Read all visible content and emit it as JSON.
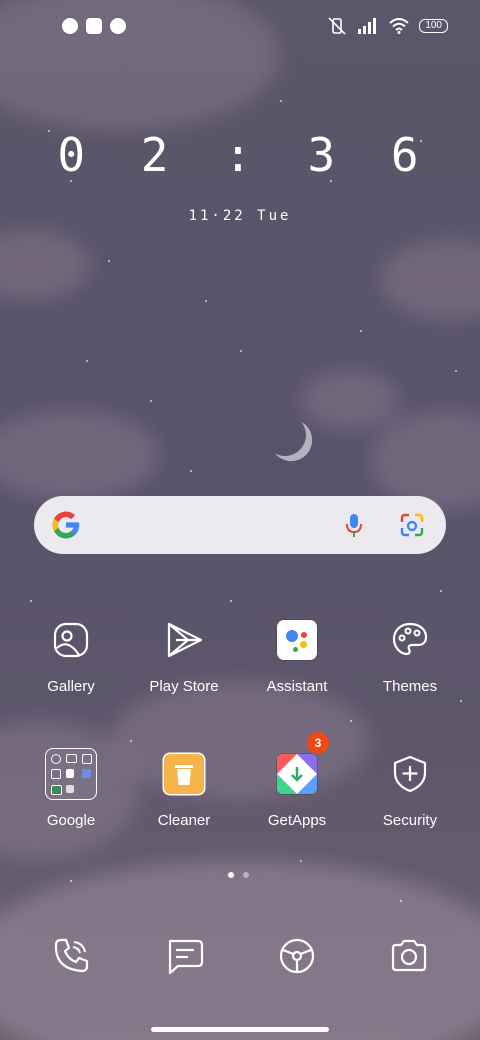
{
  "status_bar": {
    "left_icons": [
      "notification-app-icon",
      "notification-square-icon",
      "notification-app-icon"
    ],
    "battery": "100",
    "right_icons": [
      "vibrate-off-icon",
      "signal-icon",
      "wifi-icon",
      "battery-icon"
    ]
  },
  "clock": {
    "time": "02:36",
    "time_display": "0 2 : 3 6",
    "date": "11·22 Tue"
  },
  "search_bar": {
    "icons": [
      "google-logo-icon",
      "microphone-icon",
      "google-lens-icon"
    ]
  },
  "apps_row1": [
    {
      "label": "Gallery",
      "icon": "gallery-icon"
    },
    {
      "label": "Play Store",
      "icon": "play-store-icon"
    },
    {
      "label": "Assistant",
      "icon": "assistant-icon"
    },
    {
      "label": "Themes",
      "icon": "palette-icon"
    }
  ],
  "apps_row2": [
    {
      "label": "Google",
      "icon": "folder-icon"
    },
    {
      "label": "Cleaner",
      "icon": "trash-icon"
    },
    {
      "label": "GetApps",
      "icon": "getapps-icon",
      "badge": "3"
    },
    {
      "label": "Security",
      "icon": "shield-plus-icon"
    }
  ],
  "page_indicator": {
    "pages": 2,
    "active": 1
  },
  "dock": [
    "phone-icon",
    "messages-icon",
    "browser-icon",
    "camera-icon"
  ],
  "colors": {
    "badge": "#f04a14",
    "cleaner": "#f6b34a"
  }
}
